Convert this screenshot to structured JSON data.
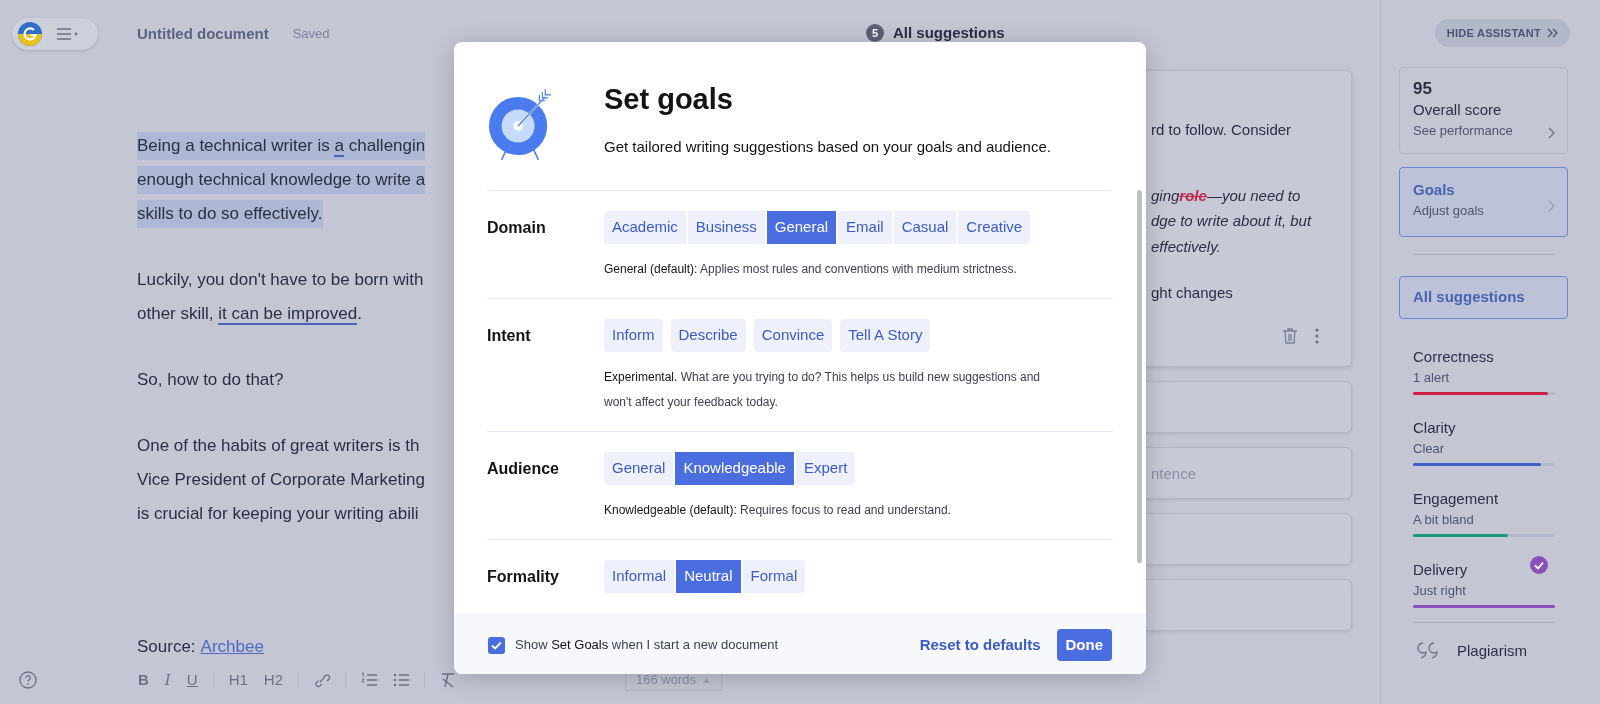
{
  "app": {
    "document_title": "Untitled document",
    "save_status": "Saved"
  },
  "editor": {
    "paragraphs": [
      {
        "highlighted": true,
        "lines": [
          [
            {
              "text": "Being a technical writer is ",
              "underlined": false
            },
            {
              "text": "a",
              "underlined": true
            },
            {
              "text": " challengin",
              "underlined": false
            }
          ],
          [
            {
              "text": "enough technical knowledge to write a",
              "underlined": false
            }
          ],
          [
            {
              "text": "skills to do so effectively.",
              "underlined": false
            }
          ]
        ]
      },
      {
        "highlighted": false,
        "lines": [
          [
            {
              "text": "Luckily, you don't have to be born with",
              "underlined": false
            }
          ],
          [
            {
              "text": "other skill, ",
              "underlined": false
            },
            {
              "text": "it can be improved",
              "underlined": true
            },
            {
              "text": ".",
              "underlined": false
            }
          ]
        ]
      },
      {
        "highlighted": false,
        "lines": [
          [
            {
              "text": "So, how to do that?",
              "underlined": false
            }
          ]
        ]
      },
      {
        "highlighted": false,
        "lines": [
          [
            {
              "text": "One of the habits of great writers is th",
              "underlined": false
            }
          ],
          [
            {
              "text": "Vice President of Corporate Marketing",
              "underlined": false
            }
          ],
          [
            {
              "text": "is crucial for keeping your writing abili",
              "underlined": false
            }
          ]
        ]
      }
    ],
    "source": {
      "label": "Source:",
      "link": "Archbee"
    }
  },
  "toolbar": {
    "formatting": [
      {
        "label": "B",
        "kind": "bold"
      },
      {
        "label": "I",
        "kind": "italic"
      },
      {
        "label": "U",
        "kind": "underline"
      },
      {
        "label": "H1",
        "kind": "plain"
      },
      {
        "label": "H2",
        "kind": "plain"
      }
    ],
    "word_count": "166 words"
  },
  "suggestions": {
    "count": "5",
    "title": "All suggestions",
    "expanded_card": {
      "blocks": [
        {
          "kind": "plain",
          "lines": [
            [
              {
                "text": "rd to follow. Consider",
                "kind": "plain"
              }
            ]
          ]
        },
        {
          "kind": "quote",
          "lines": [
            [
              {
                "text": "ging",
                "kind": "italic"
              },
              {
                "text": "role",
                "kind": "deleted"
              },
              {
                "text": "—you need to",
                "kind": "italic"
              }
            ],
            [
              {
                "text": "dge to write about it, but",
                "kind": "italic"
              }
            ],
            [
              {
                "text": "effectively.",
                "kind": "italic"
              }
            ]
          ]
        },
        {
          "kind": "plain",
          "lines": [
            [
              {
                "text": "ght changes",
                "kind": "plain"
              }
            ]
          ]
        }
      ]
    },
    "collapsed_cards": [
      {
        "kind": "blank"
      },
      {
        "kind": "text",
        "text_fragment": "ntence"
      },
      {
        "kind": "blank"
      },
      {
        "kind": "blank"
      }
    ]
  },
  "sidebar": {
    "hide_button": "HIDE ASSISTANT",
    "score": {
      "value": "95",
      "label": "Overall score",
      "link": "See performance"
    },
    "goals": {
      "title": "Goals",
      "subtitle": "Adjust goals",
      "selected": true
    },
    "all_suggestions": {
      "label": "All suggestions",
      "selected": true
    },
    "categories": [
      {
        "name": "Correctness",
        "status": "1 alert",
        "level": 0.95,
        "color": "#d0204a",
        "checked": false
      },
      {
        "name": "Clarity",
        "status": "Clear",
        "level": 0.9,
        "color": "#3d5fc8",
        "checked": false
      },
      {
        "name": "Engagement",
        "status": "A bit bland",
        "level": 0.67,
        "color": "#1a9a7c",
        "checked": false
      },
      {
        "name": "Delivery",
        "status": "Just right",
        "level": 1,
        "color": "#8a52b8",
        "checked": true
      }
    ],
    "plagiarism": "Plagiarism"
  },
  "modal": {
    "title": "Set goals",
    "subtitle": "Get tailored writing suggestions based on your goals and audience.",
    "sections": [
      {
        "label": "Domain",
        "kind": "segmented",
        "options": [
          {
            "label": "Academic",
            "selected": false
          },
          {
            "label": "Business",
            "selected": false
          },
          {
            "label": "General",
            "selected": true
          },
          {
            "label": "Email",
            "selected": false
          },
          {
            "label": "Casual",
            "selected": false
          },
          {
            "label": "Creative",
            "selected": false
          }
        ],
        "description": "**General (default):** Applies most rules and conventions with medium strictness."
      },
      {
        "label": "Intent",
        "kind": "pills",
        "options": [
          {
            "label": "Inform",
            "selected": false
          },
          {
            "label": "Describe",
            "selected": false
          },
          {
            "label": "Convince",
            "selected": false
          },
          {
            "label": "Tell A Story",
            "selected": false
          }
        ],
        "description": "**Experimental.** What are you trying to do? This helps us build new suggestions and won't affect your feedback today."
      },
      {
        "label": "Audience",
        "kind": "segmented",
        "options": [
          {
            "label": "General",
            "selected": false
          },
          {
            "label": "Knowledgeable",
            "selected": true
          },
          {
            "label": "Expert",
            "selected": false
          }
        ],
        "description": "**Knowledgeable (default):** Requires focus to read and understand."
      },
      {
        "label": "Formality",
        "kind": "segmented",
        "options": [
          {
            "label": "Informal",
            "selected": false
          },
          {
            "label": "Neutral",
            "selected": true
          },
          {
            "label": "Formal",
            "selected": false
          }
        ]
      }
    ],
    "footer": {
      "checkbox": {
        "label": "Show **Set Goals** when I start a new document",
        "checked": true
      },
      "reset": "Reset to defaults",
      "done": "Done"
    }
  }
}
